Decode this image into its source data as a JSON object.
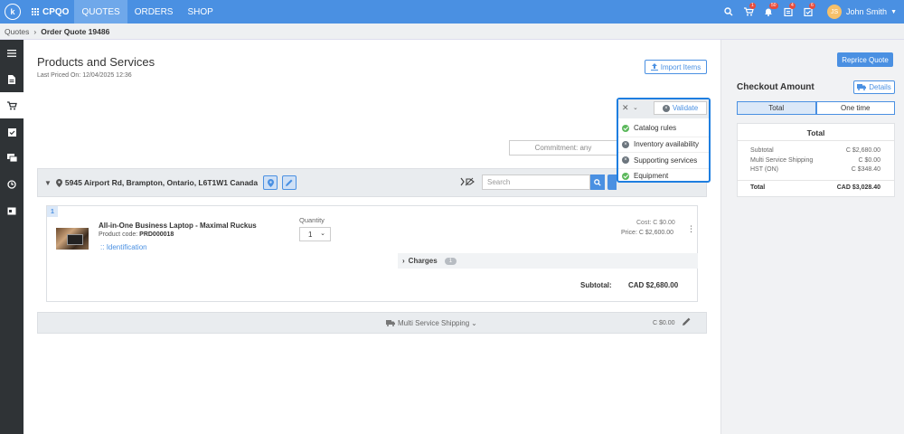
{
  "topbar": {
    "logo": "k",
    "brand": "CPQO",
    "nav": [
      "QUOTES",
      "ORDERS",
      "SHOP"
    ],
    "badges": {
      "cart": "1",
      "bell": "50",
      "tasks": "4",
      "approvals": "6"
    },
    "avatar_initials": "JS",
    "user_name": "John Smith"
  },
  "breadcrumb": {
    "root": "Quotes",
    "current": "Order Quote 19486"
  },
  "main": {
    "title": "Products and Services",
    "last_priced_label": "Last Priced On:",
    "last_priced_value": "12/04/2025 12:36",
    "import_label": "Import Items",
    "commitment_label": "Commitment: any",
    "address": "5945 Airport Rd, Brampton, Ontario, L6T1W1 Canada",
    "search_placeholder": "Search",
    "item": {
      "number": "1",
      "name": "All-in-One Business Laptop - Maximal Ruckus",
      "code_label": "Product code:",
      "code_value": "PRD000018",
      "identification": "Identification",
      "quantity_label": "Quantity",
      "quantity_value": "1",
      "cost": "Cost:   C $0.00",
      "price": "Price:  C $2,600.00",
      "charges_label": "Charges",
      "charges_count": "1",
      "subtotal_label": "Subtotal:",
      "subtotal_value": "CAD $2,680.00"
    },
    "shipping": {
      "label": "Multi Service Shipping",
      "value": "C $0.00"
    }
  },
  "validate": {
    "button": "Validate",
    "items": [
      {
        "label": "Catalog rules",
        "status": "ok"
      },
      {
        "label": "Inventory availability",
        "status": "fail"
      },
      {
        "label": "Supporting services",
        "status": "fail"
      },
      {
        "label": "Equipment",
        "status": "ok"
      }
    ]
  },
  "checkout": {
    "reprice": "Reprice Quote",
    "title": "Checkout Amount",
    "details": "Details",
    "tabs": [
      "Total",
      "One time"
    ],
    "summary_title": "Total",
    "rows": [
      {
        "label": "Subtotal",
        "value": "C $2,680.00"
      },
      {
        "label": "Multi Service Shipping",
        "value": "C $0.00"
      },
      {
        "label": "HST (ON)",
        "value": "C $348.40"
      }
    ],
    "total_label": "Total",
    "total_value": "CAD $3,028.40"
  },
  "colors": {
    "primary": "#4a90e2",
    "sidebar": "#2f3336",
    "highlight": "#1e7ee0"
  }
}
